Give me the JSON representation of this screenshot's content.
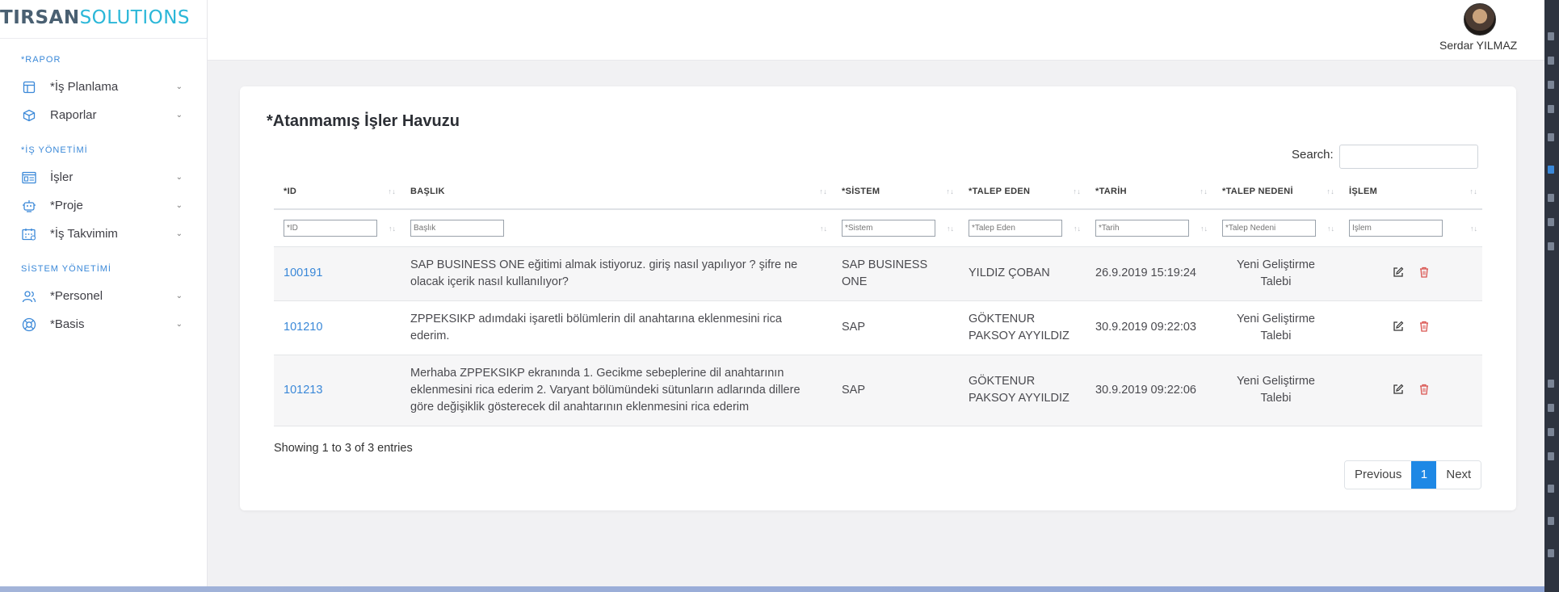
{
  "brand": {
    "bold": "TIRSAN",
    "light": "SOLUTIONS"
  },
  "user": {
    "name": "Serdar YILMAZ"
  },
  "sidebar": {
    "sections": [
      {
        "header": "*RAPOR",
        "items": [
          {
            "label": "*İş Planlama",
            "icon": "layout-icon"
          },
          {
            "label": "Raporlar",
            "icon": "box-icon"
          }
        ]
      },
      {
        "header": "*İŞ YÖNETİMİ",
        "items": [
          {
            "label": "İşler",
            "icon": "list-window-icon"
          },
          {
            "label": "*Proje",
            "icon": "robot-icon"
          },
          {
            "label": "*İş Takvimim",
            "icon": "calendar-icon"
          }
        ]
      },
      {
        "header": "SİSTEM YÖNETİMİ",
        "items": [
          {
            "label": "*Personel",
            "icon": "users-icon"
          },
          {
            "label": "*Basis",
            "icon": "lifebuoy-icon"
          }
        ]
      }
    ]
  },
  "card": {
    "title": "*Atanmamış İşler Havuzu",
    "search_label": "Search:",
    "search_value": ""
  },
  "table": {
    "columns": [
      "*ID",
      "BAŞLIK",
      "*SİSTEM",
      "*TALEP EDEN",
      "*TARİH",
      "*TALEP NEDENİ",
      "İŞLEM"
    ],
    "filters": [
      "*ID",
      "Başlık",
      "*Sistem",
      "*Talep Eden",
      "*Tarih",
      "*Talep Nedeni",
      "İşlem"
    ],
    "rows": [
      {
        "id": "100191",
        "baslik": "SAP BUSINESS ONE eğitimi almak istiyoruz. giriş nasıl yapılıyor ? şifre ne olacak içerik nasıl kullanılıyor?",
        "sistem": "SAP BUSINESS ONE",
        "talep_eden": "YILDIZ ÇOBAN",
        "tarih": "26.9.2019 15:19:24",
        "neden": "Yeni Geliştirme Talebi"
      },
      {
        "id": "101210",
        "baslik": "ZPPEKSIKP adımdaki işaretli bölümlerin dil anahtarına eklenmesini rica ederim.",
        "sistem": "SAP",
        "talep_eden": "GÖKTENUR PAKSOY AYYILDIZ",
        "tarih": "30.9.2019 09:22:03",
        "neden": "Yeni Geliştirme Talebi"
      },
      {
        "id": "101213",
        "baslik": "Merhaba ZPPEKSIKP ekranında 1. Gecikme sebeplerine dil anahtarının eklenmesini rica ederim 2. Varyant bölümündeki sütunların adlarında dillere göre değişiklik gösterecek dil anahtarının eklenmesini rica ederim",
        "sistem": "SAP",
        "talep_eden": "GÖKTENUR PAKSOY AYYILDIZ",
        "tarih": "30.9.2019 09:22:06",
        "neden": "Yeni Geliştirme Talebi"
      }
    ]
  },
  "footer": {
    "info": "Showing 1 to 3 of 3 entries",
    "previous": "Previous",
    "page": "1",
    "next": "Next"
  },
  "colors": {
    "accent": "#3a88d8",
    "brand_light": "#2bb7d8",
    "brand_dark": "#4a6072",
    "edit": "#333333",
    "delete": "#d9534f",
    "page_active": "#1e88e5"
  }
}
